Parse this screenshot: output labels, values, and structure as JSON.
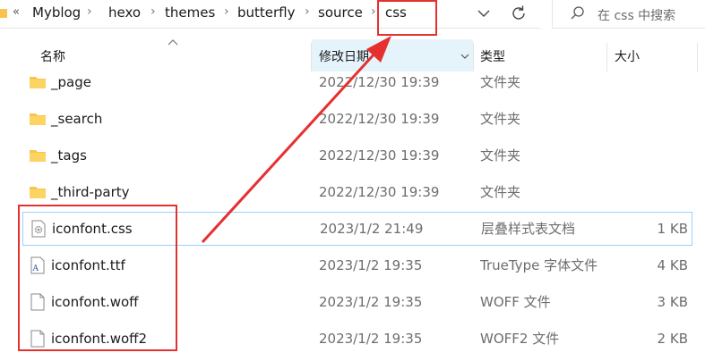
{
  "address_bar": {
    "overflow_glyph": "«",
    "crumbs": [
      "Myblog",
      "hexo",
      "themes",
      "butterfly",
      "source",
      "css"
    ],
    "separator": "›"
  },
  "search": {
    "placeholder": "在 css 中搜索"
  },
  "columns": {
    "name": "名称",
    "date": "修改日期",
    "type": "类型",
    "size": "大小"
  },
  "files": [
    {
      "name": "_page",
      "date": "2022/12/30 19:39",
      "type": "文件夹",
      "size": "",
      "icon": "folder-icon"
    },
    {
      "name": "_search",
      "date": "2022/12/30 19:39",
      "type": "文件夹",
      "size": "",
      "icon": "folder-icon"
    },
    {
      "name": "_tags",
      "date": "2022/12/30 19:39",
      "type": "文件夹",
      "size": "",
      "icon": "folder-icon"
    },
    {
      "name": "_third-party",
      "date": "2022/12/30 19:39",
      "type": "文件夹",
      "size": "",
      "icon": "folder-icon"
    },
    {
      "name": "iconfont.css",
      "date": "2023/1/2 21:49",
      "type": "层叠样式表文档",
      "size": "1 KB",
      "icon": "css-file-icon"
    },
    {
      "name": "iconfont.ttf",
      "date": "2023/1/2 19:35",
      "type": "TrueType 字体文件",
      "size": "4 KB",
      "icon": "font-file-icon"
    },
    {
      "name": "iconfont.woff",
      "date": "2023/1/2 19:35",
      "type": "WOFF 文件",
      "size": "3 KB",
      "icon": "file-icon"
    },
    {
      "name": "iconfont.woff2",
      "date": "2023/1/2 19:35",
      "type": "WOFF2 文件",
      "size": "2 KB",
      "icon": "file-icon"
    }
  ],
  "colors": {
    "annotation": "#e5302f",
    "selection_border": "#99d1ff",
    "sorted_header_bg": "#e5f3fb",
    "folder_yellow": "#f8c44f"
  }
}
